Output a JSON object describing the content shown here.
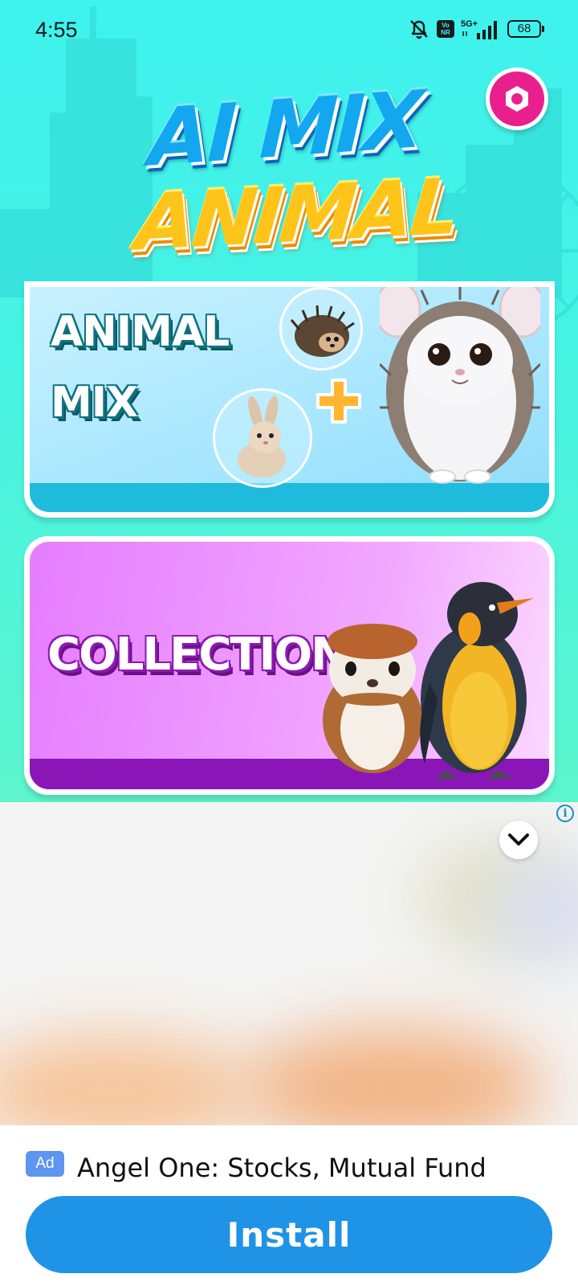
{
  "status_bar": {
    "time": "4:55",
    "network": "5G+",
    "volte_badge": "Vo NR",
    "battery": "68",
    "icons": [
      "bell-muted-icon",
      "volte-icon",
      "signal-icon",
      "battery-icon"
    ]
  },
  "app": {
    "logo_line1": "AI MIX",
    "logo_line2": "ANIMAL",
    "settings_icon": "hexagon-nut-icon",
    "accent_color": "#ea1f8e",
    "background_color": "#3ef2ee"
  },
  "cards": {
    "animal_mix": {
      "title_line1": "ANIMAL",
      "title_line2": "MIX",
      "plus_icon": "plus-icon"
    },
    "collection": {
      "title": "COLLECTION"
    }
  },
  "ad": {
    "info_label": "i",
    "badge": "Ad",
    "title": "Angel One: Stocks, Mutual Fund",
    "install_label": "Install",
    "button_color": "#1f93e6"
  }
}
